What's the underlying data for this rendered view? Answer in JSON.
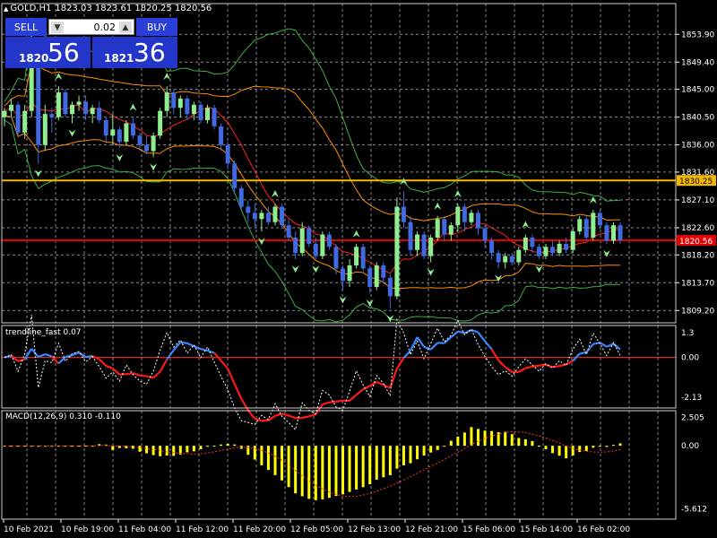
{
  "header": {
    "symbol": "GOLD,H1",
    "values": "1823.03 1823.61 1820.25 1820.56"
  },
  "trade_panel": {
    "sell_label": "SELL",
    "buy_label": "BUY",
    "lot": "0.02",
    "sell_price_small": "1820",
    "sell_price_big": "56",
    "buy_price_small": "1821",
    "buy_price_big": "36",
    "dec_icon": "arrow-down-icon",
    "inc_icon": "arrow-up-icon"
  },
  "main_axis": {
    "min": 1807.5,
    "max": 1858.0,
    "ticks": [
      "1853.90",
      "1849.40",
      "1845.00",
      "1840.50",
      "1836.00",
      "1831.60",
      "1827.10",
      "1822.60",
      "1818.20",
      "1813.70",
      "1809.20"
    ],
    "tick_values": [
      1853.9,
      1849.4,
      1845.0,
      1840.5,
      1836.0,
      1831.6,
      1827.1,
      1822.6,
      1818.2,
      1813.7,
      1809.2
    ]
  },
  "hlines": [
    {
      "label": "1830.25",
      "value": 1830.25,
      "color": "#f5b800",
      "text_color": "#000000"
    },
    {
      "label": "1820.56",
      "value": 1820.56,
      "color": "#e00000",
      "text_color": "#ffffff"
    }
  ],
  "trend_panel": {
    "title": "trendline_fast 0.07",
    "ticks": [
      "1.3",
      "0.00",
      "-2.13"
    ],
    "tick_values": [
      1.3,
      0.0,
      -2.13
    ],
    "min": -2.5,
    "max": 1.5,
    "pos_color": "#3a86ff",
    "neg_color": "#ff1a1a"
  },
  "macd_panel": {
    "title": "MACD(12,26,9) 0.310 -0.110",
    "ticks": [
      "2.505",
      "0.00",
      "-5.612"
    ],
    "tick_values": [
      2.505,
      0.0,
      -5.612
    ],
    "min": -6.2,
    "max": 2.8,
    "hist_color": "#ffff00",
    "signal_color": "#ff3030"
  },
  "time_axis": [
    "10 Feb 2021",
    "10 Feb 19:00",
    "11 Feb 04:00",
    "11 Feb 12:00",
    "11 Feb 20:00",
    "12 Feb 05:00",
    "12 Feb 13:00",
    "12 Feb 21:00",
    "15 Feb 06:00",
    "15 Feb 14:00",
    "16 Feb 02:00"
  ],
  "colors": {
    "bull": "#90ee90",
    "bear": "#4169e1",
    "grid": "#8a8a8a",
    "band_outer": "#3cb043",
    "band_mid": "#ff8c00",
    "ma": "#ff2020"
  },
  "arrow_icon": "fractal-arrow-icon",
  "chart_data": {
    "type": "candlestick",
    "series": [
      {
        "values": [
          1840.5,
          1842.0,
          1839.0,
          1841.5
        ]
      },
      {
        "values": [
          1841.5,
          1843.5,
          1840.5,
          1842.5
        ]
      },
      {
        "values": [
          1842.5,
          1843.0,
          1837.5,
          1838.0
        ]
      },
      {
        "values": [
          1838.0,
          1842.5,
          1837.0,
          1841.5
        ]
      },
      {
        "values": [
          1841.5,
          1854.5,
          1840.5,
          1851.0
        ]
      },
      {
        "values": [
          1851.0,
          1852.0,
          1833.0,
          1836.0
        ]
      },
      {
        "values": [
          1836.0,
          1842.5,
          1835.0,
          1841.0
        ]
      },
      {
        "values": [
          1841.0,
          1842.0,
          1838.0,
          1840.5
        ]
      },
      {
        "values": [
          1840.5,
          1845.5,
          1840.0,
          1844.5
        ]
      },
      {
        "values": [
          1844.5,
          1845.0,
          1840.5,
          1841.0
        ]
      },
      {
        "values": [
          1841.0,
          1843.0,
          1839.5,
          1842.5
        ]
      },
      {
        "values": [
          1842.5,
          1844.0,
          1841.5,
          1843.0
        ]
      },
      {
        "values": [
          1843.0,
          1844.0,
          1840.0,
          1841.0
        ]
      },
      {
        "values": [
          1841.0,
          1842.5,
          1839.5,
          1842.0
        ]
      },
      {
        "values": [
          1842.0,
          1843.0,
          1839.5,
          1840.0
        ]
      },
      {
        "values": [
          1840.0,
          1840.5,
          1836.5,
          1837.5
        ]
      },
      {
        "values": [
          1837.5,
          1841.0,
          1836.0,
          1838.5
        ]
      },
      {
        "values": [
          1838.5,
          1839.0,
          1835.5,
          1836.5
        ]
      },
      {
        "values": [
          1836.5,
          1840.0,
          1836.0,
          1839.5
        ]
      },
      {
        "values": [
          1839.5,
          1840.5,
          1837.0,
          1837.5
        ]
      },
      {
        "values": [
          1837.5,
          1838.0,
          1835.0,
          1836.0
        ]
      },
      {
        "values": [
          1836.0,
          1837.5,
          1834.5,
          1835.0
        ]
      },
      {
        "values": [
          1835.0,
          1838.0,
          1834.0,
          1837.5
        ]
      },
      {
        "values": [
          1837.5,
          1842.0,
          1837.0,
          1841.5
        ]
      },
      {
        "values": [
          1841.5,
          1845.5,
          1840.5,
          1844.5
        ]
      },
      {
        "values": [
          1844.5,
          1845.0,
          1841.0,
          1842.0
        ]
      },
      {
        "values": [
          1842.0,
          1844.0,
          1840.5,
          1843.5
        ]
      },
      {
        "values": [
          1843.5,
          1844.0,
          1840.0,
          1841.0
        ]
      },
      {
        "values": [
          1841.0,
          1843.0,
          1840.0,
          1842.5
        ]
      },
      {
        "values": [
          1842.5,
          1843.0,
          1839.5,
          1840.0
        ]
      },
      {
        "values": [
          1840.0,
          1842.5,
          1839.5,
          1842.0
        ]
      },
      {
        "values": [
          1842.0,
          1842.5,
          1838.5,
          1839.0
        ]
      },
      {
        "values": [
          1839.0,
          1839.5,
          1835.0,
          1836.0
        ]
      },
      {
        "values": [
          1836.0,
          1836.5,
          1832.0,
          1833.0
        ]
      },
      {
        "values": [
          1833.0,
          1833.5,
          1828.0,
          1829.0
        ]
      },
      {
        "values": [
          1829.0,
          1829.5,
          1825.5,
          1826.0
        ]
      },
      {
        "values": [
          1826.0,
          1827.0,
          1823.5,
          1825.0
        ]
      },
      {
        "values": [
          1825.0,
          1826.5,
          1822.5,
          1824.0
        ]
      },
      {
        "values": [
          1824.0,
          1825.5,
          1822.0,
          1825.0
        ]
      },
      {
        "values": [
          1825.0,
          1826.0,
          1823.0,
          1823.5
        ]
      },
      {
        "values": [
          1823.5,
          1826.5,
          1823.0,
          1826.0
        ]
      },
      {
        "values": [
          1826.0,
          1826.5,
          1822.5,
          1823.0
        ]
      },
      {
        "values": [
          1823.0,
          1824.0,
          1820.5,
          1821.0
        ]
      },
      {
        "values": [
          1821.0,
          1822.0,
          1817.5,
          1818.5
        ]
      },
      {
        "values": [
          1818.5,
          1823.5,
          1818.0,
          1822.5
        ]
      },
      {
        "values": [
          1822.5,
          1823.0,
          1819.5,
          1820.0
        ]
      },
      {
        "values": [
          1820.0,
          1821.0,
          1817.5,
          1818.0
        ]
      },
      {
        "values": [
          1818.0,
          1822.0,
          1817.5,
          1821.5
        ]
      },
      {
        "values": [
          1821.5,
          1822.0,
          1819.0,
          1819.5
        ]
      },
      {
        "values": [
          1819.5,
          1820.0,
          1815.0,
          1816.0
        ]
      },
      {
        "values": [
          1816.0,
          1816.5,
          1812.5,
          1814.0
        ]
      },
      {
        "values": [
          1814.0,
          1817.5,
          1813.0,
          1816.5
        ]
      },
      {
        "values": [
          1816.5,
          1820.0,
          1816.0,
          1819.5
        ]
      },
      {
        "values": [
          1819.5,
          1820.0,
          1815.5,
          1816.0
        ]
      },
      {
        "values": [
          1816.0,
          1816.5,
          1812.0,
          1813.0
        ]
      },
      {
        "values": [
          1813.0,
          1817.0,
          1812.5,
          1816.5
        ]
      },
      {
        "values": [
          1816.5,
          1817.0,
          1813.5,
          1814.5
        ]
      },
      {
        "values": [
          1814.5,
          1815.0,
          1809.5,
          1811.5
        ]
      },
      {
        "values": [
          1811.5,
          1827.5,
          1811.0,
          1826.0
        ]
      },
      {
        "values": [
          1826.0,
          1828.5,
          1822.5,
          1823.5
        ]
      },
      {
        "values": [
          1823.5,
          1824.5,
          1818.0,
          1819.0
        ]
      },
      {
        "values": [
          1819.0,
          1822.0,
          1818.0,
          1821.5
        ]
      },
      {
        "values": [
          1821.5,
          1822.0,
          1817.5,
          1818.0
        ]
      },
      {
        "values": [
          1818.0,
          1821.5,
          1817.0,
          1821.0
        ]
      },
      {
        "values": [
          1821.0,
          1824.5,
          1820.5,
          1824.0
        ]
      },
      {
        "values": [
          1824.0,
          1824.5,
          1820.5,
          1821.5
        ]
      },
      {
        "values": [
          1821.5,
          1823.5,
          1820.5,
          1823.0
        ]
      },
      {
        "values": [
          1823.0,
          1826.5,
          1822.0,
          1826.0
        ]
      },
      {
        "values": [
          1826.0,
          1826.5,
          1822.0,
          1823.5
        ]
      },
      {
        "values": [
          1823.5,
          1825.5,
          1823.0,
          1825.0
        ]
      },
      {
        "values": [
          1825.0,
          1825.5,
          1821.5,
          1822.5
        ]
      },
      {
        "values": [
          1822.5,
          1823.0,
          1819.5,
          1820.5
        ]
      },
      {
        "values": [
          1820.5,
          1821.0,
          1817.5,
          1818.5
        ]
      },
      {
        "values": [
          1818.5,
          1819.0,
          1816.0,
          1817.0
        ]
      },
      {
        "values": [
          1817.0,
          1818.5,
          1816.0,
          1818.0
        ]
      },
      {
        "values": [
          1818.0,
          1818.5,
          1816.5,
          1817.0
        ]
      },
      {
        "values": [
          1817.0,
          1819.5,
          1816.5,
          1819.0
        ]
      },
      {
        "values": [
          1819.0,
          1821.5,
          1818.5,
          1821.0
        ]
      },
      {
        "values": [
          1821.0,
          1821.5,
          1818.5,
          1819.5
        ]
      },
      {
        "values": [
          1819.5,
          1820.0,
          1817.5,
          1818.0
        ]
      },
      {
        "values": [
          1818.0,
          1820.0,
          1817.5,
          1819.5
        ]
      },
      {
        "values": [
          1819.5,
          1820.5,
          1818.0,
          1818.5
        ]
      },
      {
        "values": [
          1818.5,
          1820.5,
          1818.0,
          1820.0
        ]
      },
      {
        "values": [
          1820.0,
          1821.0,
          1818.5,
          1819.0
        ]
      },
      {
        "values": [
          1819.0,
          1822.5,
          1818.5,
          1822.0
        ]
      },
      {
        "values": [
          1822.0,
          1824.5,
          1821.5,
          1824.0
        ]
      },
      {
        "values": [
          1824.0,
          1824.5,
          1820.5,
          1821.0
        ]
      },
      {
        "values": [
          1821.0,
          1825.5,
          1820.5,
          1825.0
        ]
      },
      {
        "values": [
          1825.0,
          1825.5,
          1822.5,
          1823.0
        ]
      },
      {
        "values": [
          1823.0,
          1823.5,
          1820.0,
          1820.5
        ]
      },
      {
        "values": [
          1820.5,
          1823.5,
          1820.0,
          1823.0
        ]
      },
      {
        "values": [
          1823.0,
          1823.5,
          1820.0,
          1820.56
        ]
      }
    ]
  }
}
